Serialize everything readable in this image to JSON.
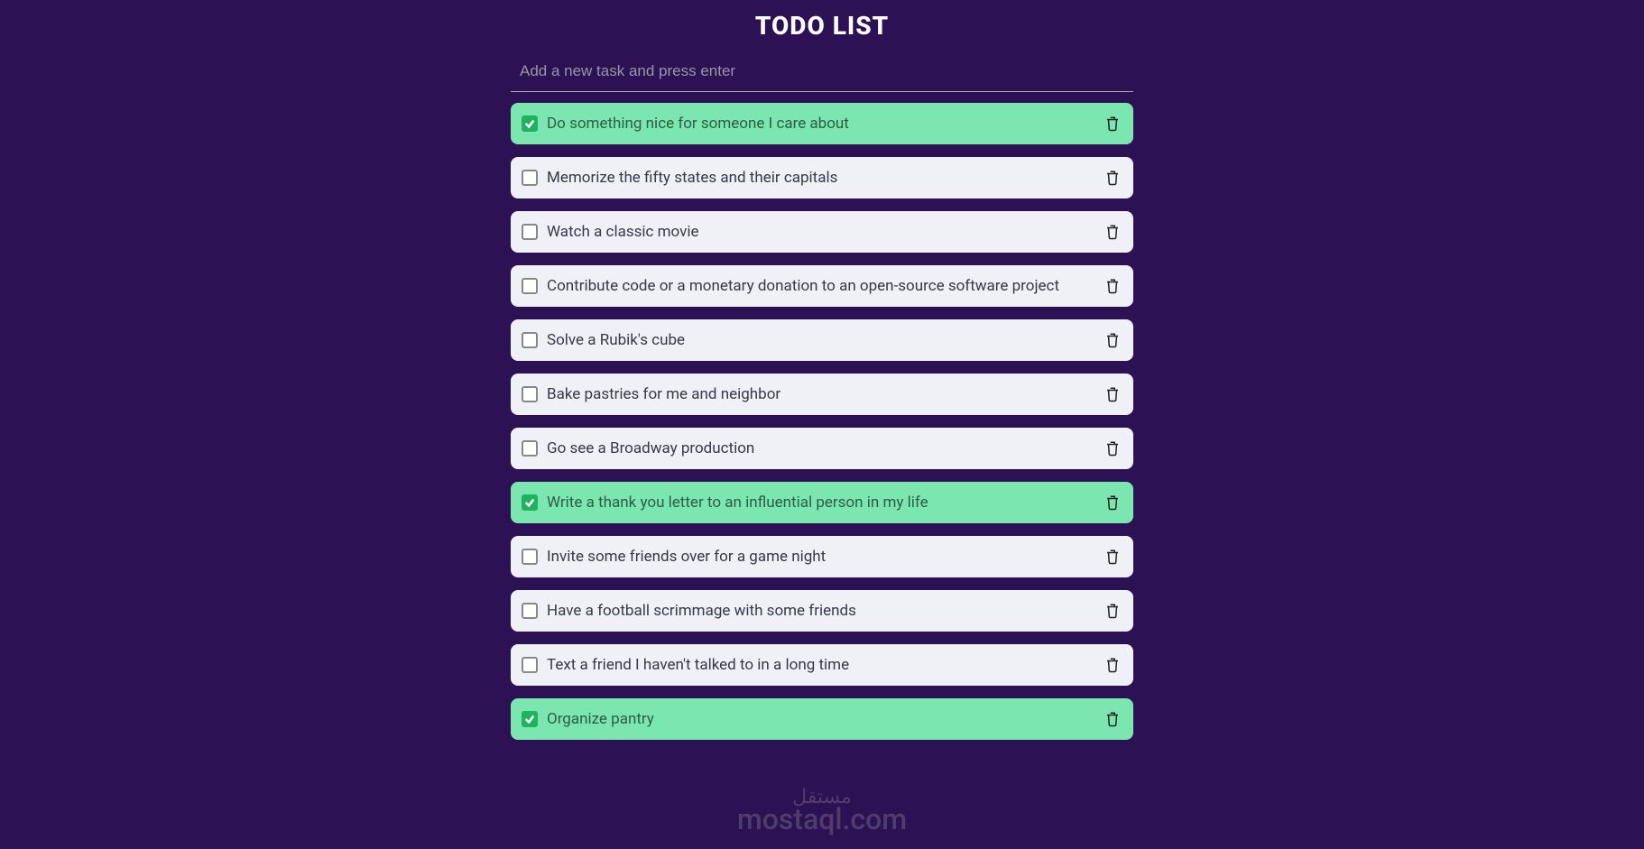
{
  "title": "TODO LIST",
  "input": {
    "placeholder": "Add a new task and press enter",
    "value": ""
  },
  "tasks": [
    {
      "label": "Do something nice for someone I care about",
      "done": true
    },
    {
      "label": "Memorize the fifty states and their capitals",
      "done": false
    },
    {
      "label": "Watch a classic movie",
      "done": false
    },
    {
      "label": "Contribute code or a monetary donation to an open-source software project",
      "done": false
    },
    {
      "label": "Solve a Rubik's cube",
      "done": false
    },
    {
      "label": "Bake pastries for me and neighbor",
      "done": false
    },
    {
      "label": "Go see a Broadway production",
      "done": false
    },
    {
      "label": "Write a thank you letter to an influential person in my life",
      "done": true
    },
    {
      "label": "Invite some friends over for a game night",
      "done": false
    },
    {
      "label": "Have a football scrimmage with some friends",
      "done": false
    },
    {
      "label": "Text a friend I haven't talked to in a long time",
      "done": false
    },
    {
      "label": "Organize pantry",
      "done": true
    }
  ],
  "watermark": {
    "line1": "مستقل",
    "line2": "mostaql.com"
  }
}
